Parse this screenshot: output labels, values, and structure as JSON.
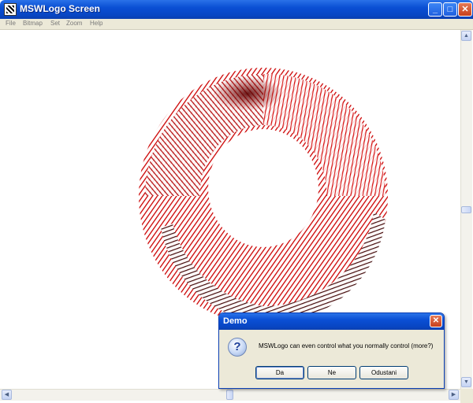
{
  "window": {
    "title": "MSWLogo Screen",
    "min_glyph": "_",
    "max_glyph": "□",
    "close_glyph": "✕"
  },
  "menu": {
    "items": [
      "File",
      "Bitmap",
      "Set",
      "Zoom",
      "Help"
    ]
  },
  "scrollbars": {
    "up_glyph": "▲",
    "down_glyph": "▼",
    "left_glyph": "◀",
    "right_glyph": "▶"
  },
  "drawing": {
    "description_color_light": "#cc0000",
    "description_color_dark": "#2a0000"
  },
  "dialog": {
    "title": "Demo",
    "close_glyph": "✕",
    "icon_glyph": "?",
    "message": "MSWLogo can even control what you normally control (more?)",
    "buttons": [
      "Da",
      "Ne",
      "Odustani"
    ]
  }
}
